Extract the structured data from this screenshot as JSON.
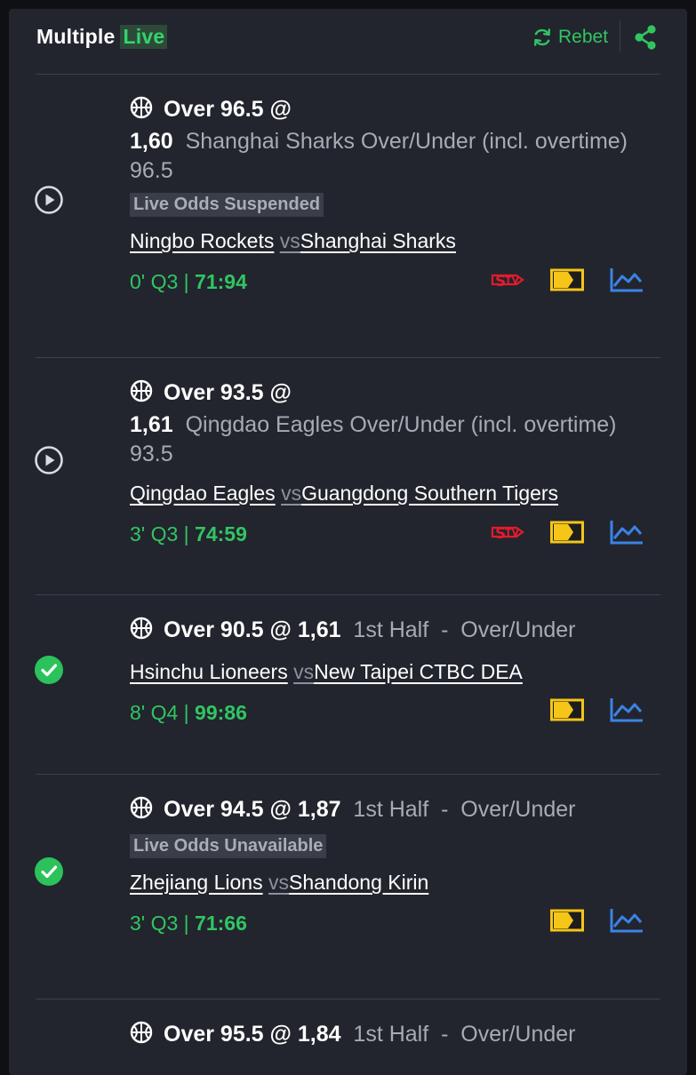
{
  "header": {
    "title": "Multiple",
    "live_badge": "Live",
    "rebet_label": "Rebet",
    "accent_color": "#31c562"
  },
  "bets": [
    {
      "status": "live-play",
      "selection": "Over 96.5 @",
      "odds": "1,60",
      "market": "Shanghai Sharks Over/Under (incl. overtime) 96.5",
      "notice": "Live Odds Suspended",
      "home": "Ningbo Rockets",
      "vs": "vs",
      "away": "Shanghai Sharks",
      "clock": "0' Q3",
      "score": "71:94",
      "icons": [
        "streaming-tv-icon",
        "scoreboard-icon",
        "stats-chart-icon"
      ]
    },
    {
      "status": "live-play",
      "selection": "Over 93.5 @",
      "odds": "1,61",
      "market": "Qingdao Eagles Over/Under (incl. overtime) 93.5",
      "home": "Qingdao Eagles",
      "vs": "vs",
      "away": "Guangdong Southern Tigers",
      "clock": "3' Q3",
      "score": "74:59",
      "icons": [
        "streaming-tv-icon",
        "scoreboard-icon",
        "stats-chart-icon"
      ]
    },
    {
      "status": "won",
      "selection": "Over 90.5 @ 1,61",
      "market": "1st Half  -  Over/Under",
      "home": "Hsinchu Lioneers",
      "vs": "vs",
      "away": "New Taipei CTBC DEA",
      "clock": "8' Q4",
      "score": "99:86",
      "icons": [
        "scoreboard-icon",
        "stats-chart-icon"
      ]
    },
    {
      "status": "won",
      "selection": "Over 94.5 @ 1,87",
      "market": "1st Half  -  Over/Under",
      "notice": "Live Odds Unavailable",
      "home": "Zhejiang Lions",
      "vs": "vs",
      "away": "Shandong Kirin",
      "clock": "3' Q3",
      "score": "71:66",
      "icons": [
        "scoreboard-icon",
        "stats-chart-icon"
      ]
    },
    {
      "status": "unknown",
      "selection": "Over 95.5 @ 1,84",
      "market": "1st Half  -  Over/Under"
    }
  ]
}
